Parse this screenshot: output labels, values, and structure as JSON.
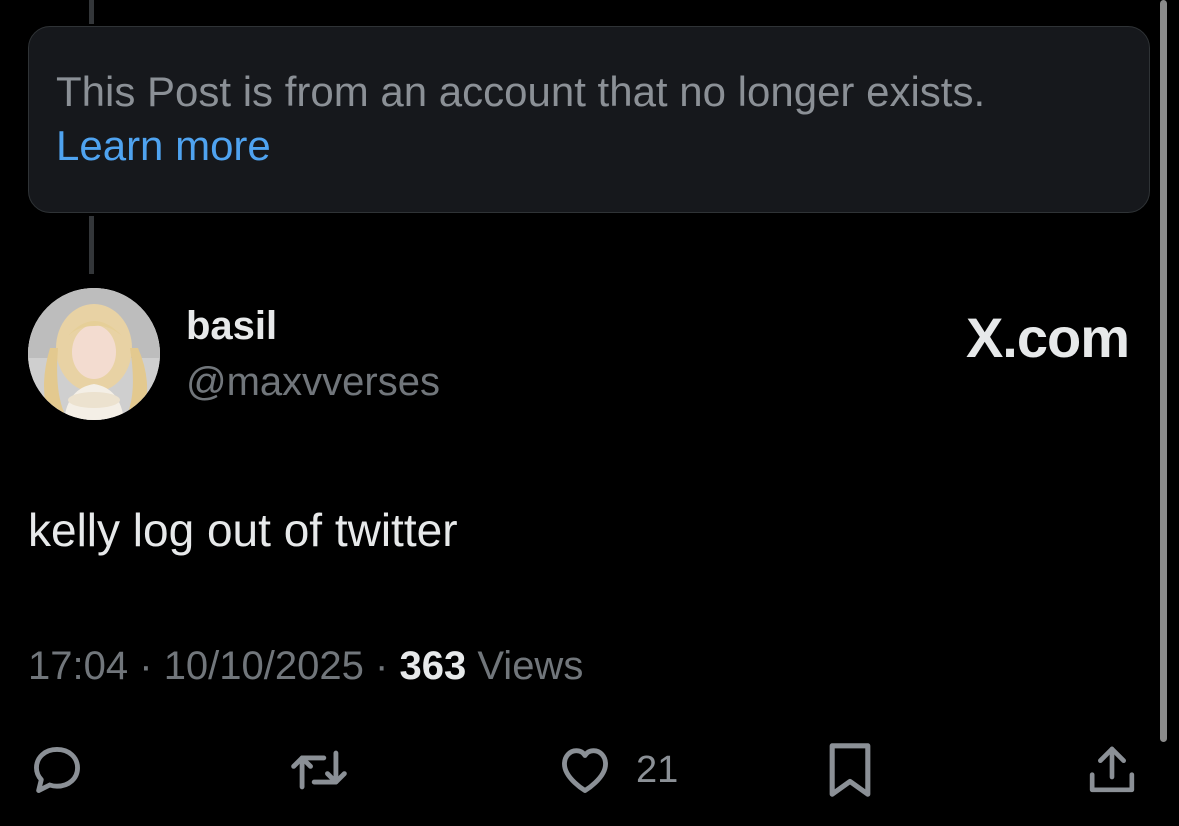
{
  "notice": {
    "text": "This Post is from an account that no longer exists.",
    "link_label": "Learn more"
  },
  "author": {
    "display_name": "basil",
    "handle": "@maxvverses",
    "avatar_icon": "profile-photo"
  },
  "brand": {
    "label": "X.com"
  },
  "post": {
    "text": "kelly log out of twitter"
  },
  "meta": {
    "time": "17:04",
    "separator": "·",
    "date": "10/10/2025",
    "views_count": "363",
    "views_label": "Views"
  },
  "actions": {
    "reply_icon": "reply-icon",
    "repost_icon": "repost-icon",
    "like_icon": "heart-icon",
    "like_count": "21",
    "bookmark_icon": "bookmark-icon",
    "share_icon": "share-icon"
  },
  "colors": {
    "background": "#000000",
    "notice_background": "#16181c",
    "link": "#4fa3f0",
    "primary_text": "#e7e9ea",
    "secondary_text": "#71767b"
  }
}
